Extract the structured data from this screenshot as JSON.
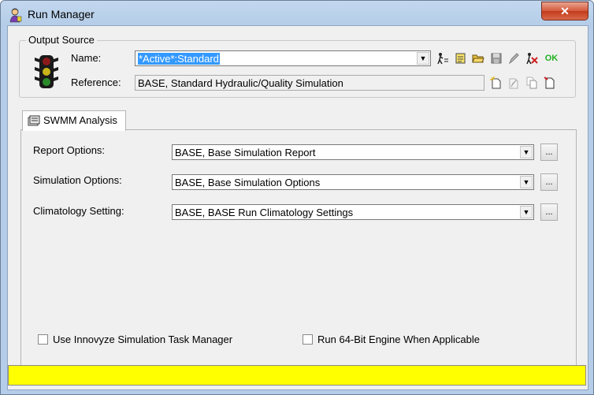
{
  "window": {
    "title": "Run Manager",
    "close_label": "✕"
  },
  "output_source": {
    "group_label": "Output Source",
    "name_label": "Name:",
    "name_value": "*Active*:Standard",
    "reference_label": "Reference:",
    "reference_value": "BASE, Standard Hydraulic/Quality Simulation",
    "ok_label": "OK"
  },
  "tab": {
    "label": "SWMM Analysis"
  },
  "options": [
    {
      "label": "Report Options:",
      "value": "BASE, Base Simulation Report"
    },
    {
      "label": "Simulation Options:",
      "value": "BASE, Base Simulation Options"
    },
    {
      "label": "Climatology Setting:",
      "value": "BASE, BASE Run Climatology Settings"
    }
  ],
  "ellipsis_label": "...",
  "checkboxes": [
    {
      "label": "Use Innovyze Simulation Task Manager",
      "checked": false
    },
    {
      "label": "Run 64-Bit Engine When Applicable",
      "checked": false
    }
  ],
  "status": {
    "text": "",
    "color": "#ffff00"
  }
}
